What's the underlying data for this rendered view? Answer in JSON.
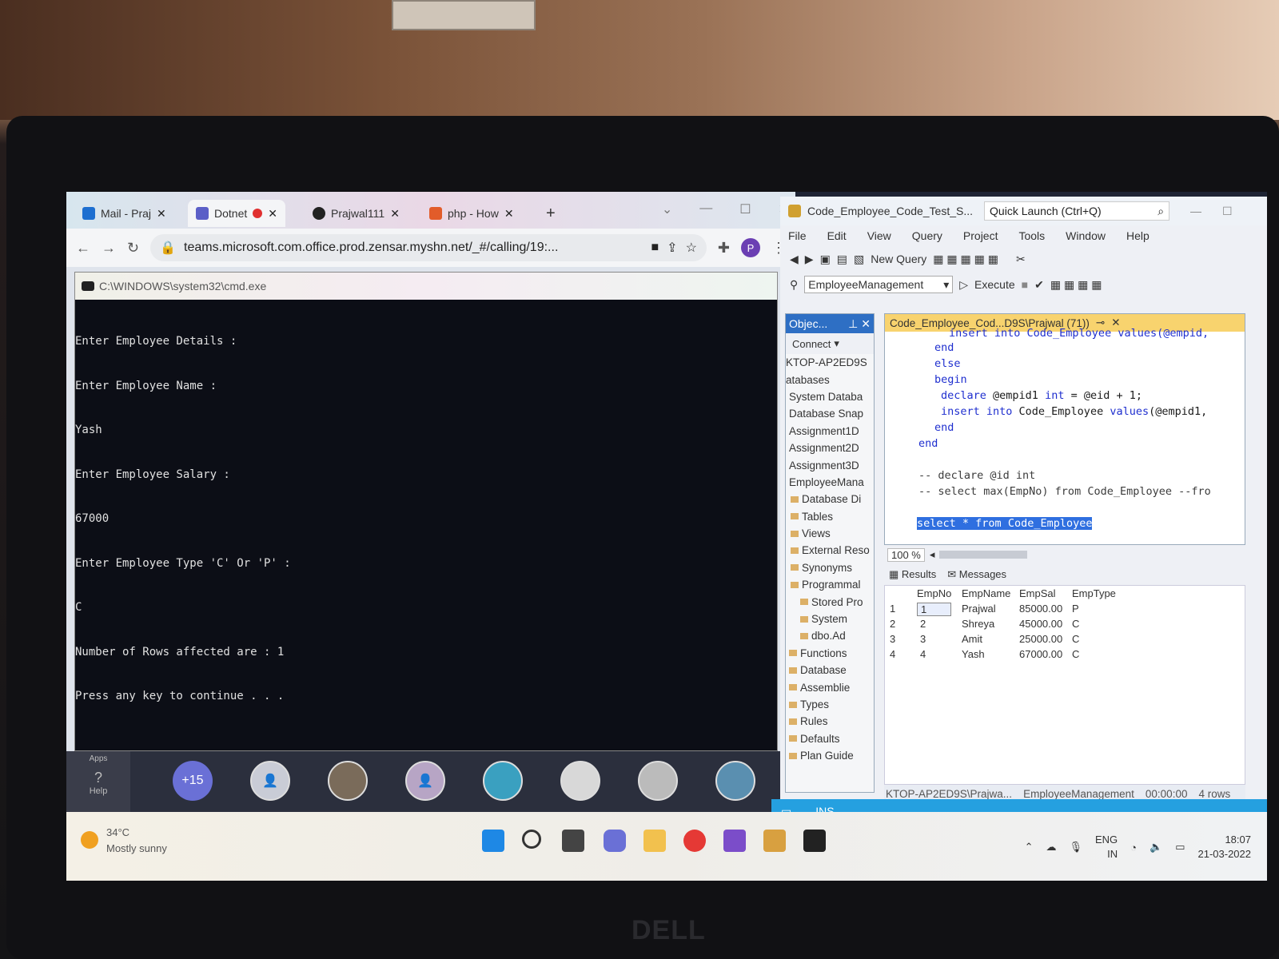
{
  "browser": {
    "tabs": [
      {
        "label": "Mail - Praj"
      },
      {
        "label": "Dotnet"
      },
      {
        "label": "Prajwal111"
      },
      {
        "label": "php - How"
      }
    ],
    "new_tab": "+",
    "url": "teams.microsoft.com.office.prod.zensar.myshn.net/_#/calling/19:...",
    "profile_initial": "P",
    "minimize": "—",
    "maximize": "☐",
    "close": "✕"
  },
  "cmd": {
    "title": "C:\\WINDOWS\\system32\\cmd.exe",
    "lines": [
      "Enter Employee Details :",
      "Enter Employee Name :",
      "Yash",
      "Enter Employee Salary :",
      "67000",
      "Enter Employee Type 'C' Or 'P' :",
      "C",
      "Number of Rows affected are : 1",
      "Press any key to continue . . ."
    ]
  },
  "teams": {
    "help_label": "Help",
    "apps_label": "Apps",
    "more_count": "+15"
  },
  "ssms": {
    "title": "Code_Employee_Code_Test_S...",
    "quick_launch": "Quick Launch (Ctrl+Q)",
    "menu": [
      "File",
      "Edit",
      "View",
      "Query",
      "Project",
      "Tools",
      "Window",
      "Help"
    ],
    "new_query": "New Query",
    "database": "EmployeeManagement",
    "execute": "Execute",
    "object_explorer": {
      "title": "Objec...",
      "connect": "Connect",
      "items": [
        "KTOP-AP2ED9S",
        "atabases",
        "System Databa",
        "Database Snap",
        "Assignment1D",
        "Assignment2D",
        "Assignment3D",
        "EmployeeMana",
        "Database Di",
        "Tables",
        "Views",
        "External Reso",
        "Synonyms",
        "Programmal",
        "Stored Pro",
        "System",
        "dbo.Ad",
        "Functions",
        "Database",
        "Assemblie",
        "Types",
        "Rules",
        "Defaults",
        "Plan Guide"
      ]
    },
    "editor_tab": "Code_Employee_Cod...D9S\\Prajwal (71))",
    "code": {
      "l1": "insert into Code_Employee values(@empid,",
      "l2": "end",
      "l3": "else",
      "l4": "begin",
      "l5a": "declare",
      "l5b": " @empid1 ",
      "l5c": "int",
      "l5d": " = @eid + 1;",
      "l6a": "insert into",
      "l6b": " Code_Employee ",
      "l6c": "values",
      "l6d": "(@empid1,",
      "l7": "end",
      "l8": "end",
      "l9": "-- declare @id int",
      "l10": "-- select max(EmpNo) from Code_Employee --fro",
      "l11a": "select",
      "l11b": " * ",
      "l11c": "from",
      "l11d": " Code_Employee"
    },
    "zoom": "100 %",
    "results_tab": "Results",
    "messages_tab": "Messages",
    "columns": [
      "EmpNo",
      "EmpName",
      "EmpSal",
      "EmpType"
    ],
    "rows": [
      {
        "n": "1",
        "no": "1",
        "name": "Prajwal",
        "sal": "85000.00",
        "type": "P"
      },
      {
        "n": "2",
        "no": "2",
        "name": "Shreya",
        "sal": "45000.00",
        "type": "C"
      },
      {
        "n": "3",
        "no": "3",
        "name": "Amit",
        "sal": "25000.00",
        "type": "C"
      },
      {
        "n": "4",
        "no": "4",
        "name": "Yash",
        "sal": "67000.00",
        "type": "C"
      }
    ],
    "status": {
      "server": "KTOP-AP2ED9S\\Prajwa...",
      "db": "EmployeeManagement",
      "time": "00:00:00",
      "rows": "4 rows"
    },
    "ins": "INS"
  },
  "taskbar": {
    "temp": "34°C",
    "weather": "Mostly sunny",
    "lang1": "ENG",
    "lang2": "IN",
    "time": "18:07",
    "date": "21-03-2022"
  },
  "brand": "DELL"
}
